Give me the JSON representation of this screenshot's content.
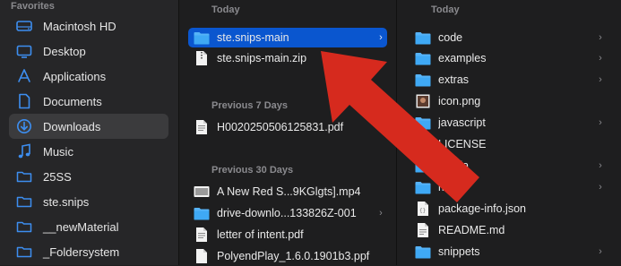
{
  "sidebar": {
    "header": "Favorites",
    "items": [
      {
        "label": "Macintosh HD",
        "icon": "disk-icon"
      },
      {
        "label": "Desktop",
        "icon": "desktop-icon"
      },
      {
        "label": "Applications",
        "icon": "applications-icon"
      },
      {
        "label": "Documents",
        "icon": "document-icon"
      },
      {
        "label": "Downloads",
        "icon": "download-icon",
        "selected": true
      },
      {
        "label": "Music",
        "icon": "music-icon"
      },
      {
        "label": "25SS",
        "icon": "folder-icon"
      },
      {
        "label": "ste.snips",
        "icon": "folder-icon"
      },
      {
        "label": "__newMaterial",
        "icon": "folder-icon"
      },
      {
        "label": "_Foldersystem",
        "icon": "folder-icon"
      }
    ]
  },
  "column1": {
    "sections": [
      {
        "title": "Today"
      },
      {
        "title": "Previous 7 Days"
      },
      {
        "title": "Previous 30 Days"
      }
    ],
    "items": [
      {
        "label": "ste.snips-main",
        "icon": "folder-icon",
        "selected": true,
        "chevron": "›"
      },
      {
        "label": "ste.snips-main.zip",
        "icon": "zip-file-icon"
      },
      {
        "label": "H0020250506125831.pdf",
        "icon": "pdf-file-icon"
      },
      {
        "label": "A New Red S...9KGlgts].mp4",
        "icon": "video-file-icon"
      },
      {
        "label": "drive-downlo...133826Z-001",
        "icon": "folder-icon",
        "chevron": "›"
      },
      {
        "label": "letter of intent.pdf",
        "icon": "pdf-file-icon"
      },
      {
        "label": "PolyendPlay_1.6.0.1901b3.ppf",
        "icon": "file-icon"
      }
    ]
  },
  "column2": {
    "section": "Today",
    "items": [
      {
        "label": "code",
        "icon": "folder-icon",
        "chevron": "›"
      },
      {
        "label": "examples",
        "icon": "folder-icon",
        "chevron": "›"
      },
      {
        "label": "extras",
        "icon": "folder-icon",
        "chevron": "›"
      },
      {
        "label": "icon.png",
        "icon": "image-file-icon"
      },
      {
        "label": "javascript",
        "icon": "folder-icon",
        "chevron": "›"
      },
      {
        "label": "LICENSE",
        "icon": "text-file-icon"
      },
      {
        "label": "media",
        "icon": "folder-icon",
        "chevron": "›"
      },
      {
        "label": "misc",
        "icon": "folder-icon",
        "chevron": "›"
      },
      {
        "label": "package-info.json",
        "icon": "json-file-icon"
      },
      {
        "label": "README.md",
        "icon": "markdown-file-icon"
      },
      {
        "label": "snippets",
        "icon": "folder-icon",
        "chevron": "›"
      }
    ]
  },
  "colors": {
    "accent": "#0a56cf",
    "folder": "#3fa9f5",
    "arrow": "#d62a1e",
    "sidebar_icon": "#3d8ef0"
  }
}
